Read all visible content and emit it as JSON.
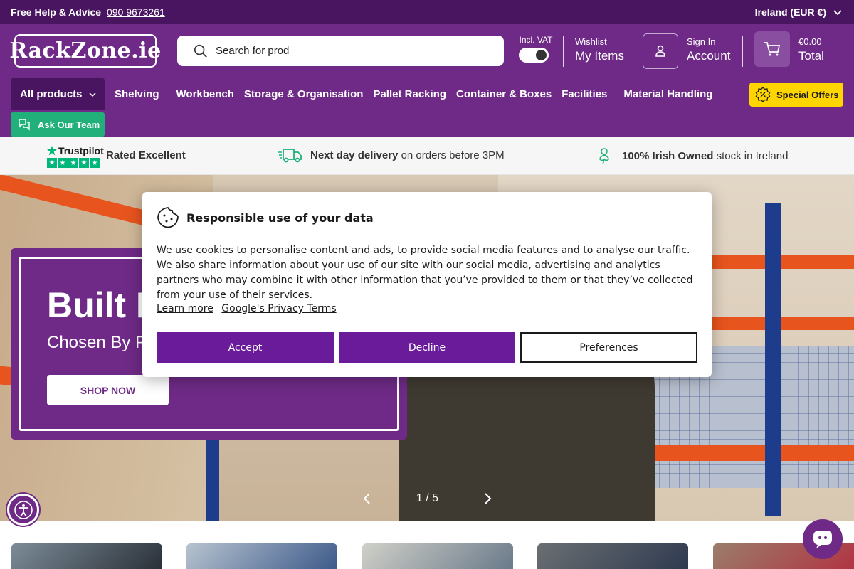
{
  "topbar": {
    "help_label": "Free Help & Advice",
    "phone": "090 9673261",
    "region": "Ireland (EUR €)"
  },
  "header": {
    "logo": "RackZone.ie",
    "search_value": "Search for prod",
    "vat_label": "Incl. VAT",
    "wishlist_small": "Wishlist",
    "wishlist_big": "My Items",
    "account_small": "Sign In",
    "account_big": "Account",
    "cart_small": "€0.00",
    "cart_big": "Total"
  },
  "nav": {
    "all_products": "All products",
    "items": [
      "Shelving",
      "Workbench",
      "Storage & Organisation",
      "Pallet Racking",
      "Container & Boxes",
      "Facilities",
      "Material Handling"
    ],
    "special_offers": "Special Offers",
    "ask_team": "Ask Our Team"
  },
  "trust": {
    "trustpilot": "Trustpilot",
    "rated": "Rated Excellent",
    "delivery_bold": "Next day delivery",
    "delivery_rest": "on orders before 3PM",
    "irish_bold": "100% Irish Owned",
    "irish_rest": "stock in Ireland"
  },
  "hero": {
    "title": "Built Fo",
    "subtitle": "Chosen By Pe",
    "cta": "SHOP NOW",
    "slide_indicator": "1 / 5"
  },
  "cookie": {
    "title": "Responsible use of your data",
    "body": "We use cookies to personalise content and ads, to provide social media features and to analyse our traffic. We also share information about your use of our site with our social media, advertising and analytics partners who may combine it with other information that you’ve provided to them or that they’ve collected from your use of their services.",
    "learn_more": "Learn more",
    "privacy": "Google's Privacy Terms",
    "accept": "Accept",
    "decline": "Decline",
    "preferences": "Preferences"
  },
  "colors": {
    "brand": "#6e2a86",
    "brand_dark": "#4a1560",
    "offers": "#ffd500",
    "ask": "#21b07a",
    "trustpilot": "#00b67a"
  },
  "icons": [
    "search-icon",
    "user-icon",
    "cart-icon",
    "chevron-down-icon",
    "percent-badge-icon",
    "chat-icon",
    "truck-icon",
    "shamrock-icon",
    "cookie-icon",
    "accessibility-icon",
    "chevron-left-icon",
    "chevron-right-icon",
    "star-icon"
  ]
}
